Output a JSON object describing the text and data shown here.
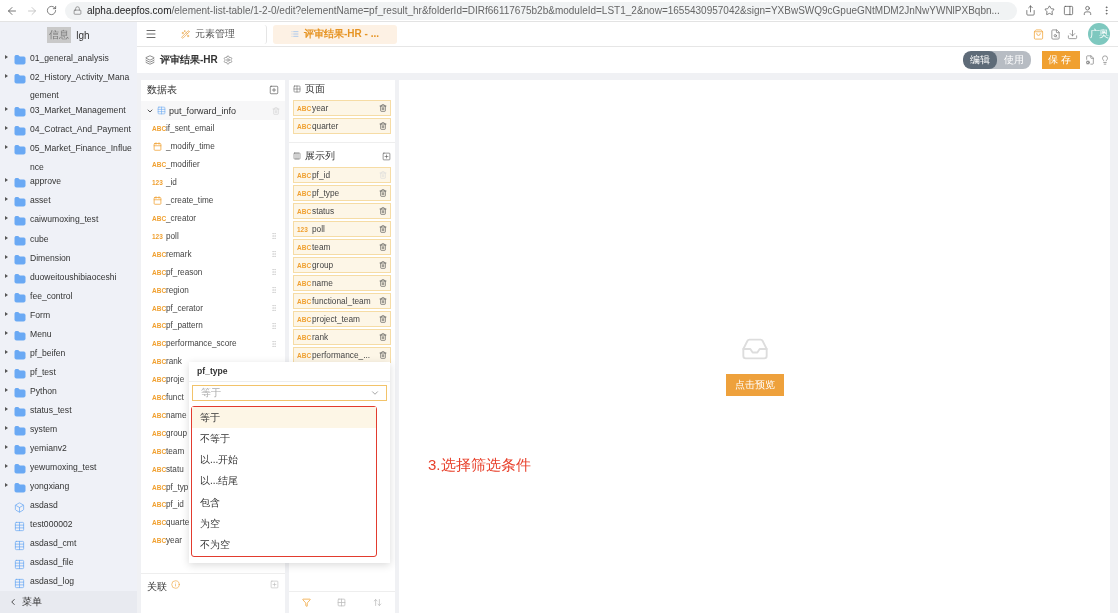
{
  "browser": {
    "url_host": "alpha.deepfos.com",
    "url_path": "/element-list-table/1-2-0/edit?elementName=pf_result_hr&folderId=DIRf66117675b2b&moduleId=LST1_2&now=1655430957042&sign=YXBwSWQ9cGpueGNtMDM2JnNwYWNlPXBqbn..."
  },
  "sidebar": {
    "user_badge": "信息",
    "user": "lgh",
    "footer": "菜单",
    "items": [
      {
        "label": "01_general_analysis",
        "kind": "folder"
      },
      {
        "label": "02_History_Activity_Management",
        "kind": "folder"
      },
      {
        "label": "03_Market_Management",
        "kind": "folder"
      },
      {
        "label": "04_Cotract_And_Payment",
        "kind": "folder"
      },
      {
        "label": "05_Market_Finance_Influence",
        "kind": "folder"
      },
      {
        "label": "approve",
        "kind": "folder"
      },
      {
        "label": "asset",
        "kind": "folder"
      },
      {
        "label": "caiwumoxing_test",
        "kind": "folder"
      },
      {
        "label": "cube",
        "kind": "folder"
      },
      {
        "label": "Dimension",
        "kind": "folder"
      },
      {
        "label": "duoweitoushibiaoceshi",
        "kind": "folder"
      },
      {
        "label": "fee_control",
        "kind": "folder"
      },
      {
        "label": "Form",
        "kind": "folder"
      },
      {
        "label": "Menu",
        "kind": "folder"
      },
      {
        "label": "pf_beifen",
        "kind": "folder"
      },
      {
        "label": "pf_test",
        "kind": "folder"
      },
      {
        "label": "Python",
        "kind": "folder"
      },
      {
        "label": "status_test",
        "kind": "folder"
      },
      {
        "label": "system",
        "kind": "folder"
      },
      {
        "label": "yemianv2",
        "kind": "folder"
      },
      {
        "label": "yewumoxing_test",
        "kind": "folder"
      },
      {
        "label": "yongxiang",
        "kind": "folder"
      },
      {
        "label": "asdasd",
        "kind": "cube"
      },
      {
        "label": "test000002",
        "kind": "table"
      },
      {
        "label": "asdasd_cmt",
        "kind": "table"
      },
      {
        "label": "asdasd_file",
        "kind": "table"
      },
      {
        "label": "asdasd_log",
        "kind": "table"
      }
    ]
  },
  "tabs": [
    {
      "label": "元素管理",
      "selected": false
    },
    {
      "label": "评审结果-HR - ...",
      "selected": true
    }
  ],
  "avatar": "广奥",
  "title": "评审结果-HR",
  "modes": [
    {
      "label": "编辑",
      "selected": true
    },
    {
      "label": "使用",
      "selected": false
    }
  ],
  "save": "保存",
  "data_panel": {
    "title": "数据表",
    "table": {
      "name": "put_forward_info",
      "expanded": true
    },
    "relation": "关联",
    "fields": [
      {
        "name": "if_sent_email",
        "kind": "text",
        "badge": "ABC",
        "handle": false
      },
      {
        "name": "_modify_time",
        "kind": "date",
        "handle": false
      },
      {
        "name": "_modifier",
        "kind": "text",
        "badge": "ABC",
        "handle": false
      },
      {
        "name": "_id",
        "kind": "number",
        "badge": "123",
        "handle": false
      },
      {
        "name": "_create_time",
        "kind": "date",
        "handle": false
      },
      {
        "name": "_creator",
        "kind": "text",
        "badge": "ABC",
        "handle": false
      },
      {
        "name": "poll",
        "kind": "number",
        "badge": "123",
        "handle": true
      },
      {
        "name": "remark",
        "kind": "text",
        "badge": "ABC",
        "handle": true
      },
      {
        "name": "pf_reason",
        "kind": "text",
        "badge": "ABC",
        "handle": true
      },
      {
        "name": "region",
        "kind": "text",
        "badge": "ABC",
        "handle": true
      },
      {
        "name": "pf_cerator",
        "kind": "text",
        "badge": "ABC",
        "handle": true
      },
      {
        "name": "pf_pattern",
        "kind": "text",
        "badge": "ABC",
        "handle": true
      },
      {
        "name": "performance_score",
        "kind": "text",
        "badge": "ABC",
        "handle": true
      },
      {
        "name": "rank",
        "kind": "text",
        "badge": "ABC",
        "handle": false
      },
      {
        "name": "proje",
        "kind": "text",
        "badge": "ABC",
        "handle": false
      },
      {
        "name": "funct",
        "kind": "text",
        "badge": "ABC",
        "handle": false
      },
      {
        "name": "name",
        "kind": "text",
        "badge": "ABC",
        "handle": false
      },
      {
        "name": "group",
        "kind": "text",
        "badge": "ABC",
        "handle": false
      },
      {
        "name": "team",
        "kind": "text",
        "badge": "ABC",
        "handle": false
      },
      {
        "name": "statu",
        "kind": "text",
        "badge": "ABC",
        "handle": false
      },
      {
        "name": "pf_typ",
        "kind": "text",
        "badge": "ABC",
        "handle": false
      },
      {
        "name": "pf_id",
        "kind": "text",
        "badge": "ABC",
        "handle": false
      },
      {
        "name": "quarte",
        "kind": "text",
        "badge": "ABC",
        "handle": false
      },
      {
        "name": "year",
        "kind": "text",
        "badge": "ABC",
        "handle": false
      }
    ]
  },
  "layout_panel": {
    "page_title": "页面",
    "page_fields": [
      {
        "name": "year",
        "badge": "ABC",
        "disabled": false
      },
      {
        "name": "quarter",
        "badge": "ABC",
        "disabled": false
      }
    ],
    "columns_title": "展示列",
    "columns": [
      {
        "name": "pf_id",
        "badge": "ABC",
        "disabled": true
      },
      {
        "name": "pf_type",
        "badge": "ABC",
        "disabled": false
      },
      {
        "name": "status",
        "badge": "ABC",
        "disabled": false
      },
      {
        "name": "poll",
        "badge": "123",
        "disabled": false
      },
      {
        "name": "team",
        "badge": "ABC",
        "disabled": false
      },
      {
        "name": "group",
        "badge": "ABC",
        "disabled": false
      },
      {
        "name": "name",
        "badge": "ABC",
        "disabled": false
      },
      {
        "name": "functional_team",
        "badge": "ABC",
        "disabled": false
      },
      {
        "name": "project_team",
        "badge": "ABC",
        "disabled": false
      },
      {
        "name": "rank",
        "badge": "ABC",
        "disabled": false
      },
      {
        "name": "performance_...",
        "badge": "ABC",
        "disabled": false
      }
    ],
    "toolbar": [
      {
        "kind": "filter",
        "selected": true
      },
      {
        "kind": "grid",
        "selected": false
      },
      {
        "kind": "sort",
        "selected": false
      }
    ]
  },
  "preview": {
    "button": "点击预览"
  },
  "filter_popup": {
    "field": "pf_type",
    "placeholder": "等于",
    "options": [
      {
        "label": "等于",
        "selected": true
      },
      {
        "label": "不等于",
        "selected": false
      },
      {
        "label": "以...开始",
        "selected": false
      },
      {
        "label": "以...结尾",
        "selected": false
      },
      {
        "label": "包含",
        "selected": false
      },
      {
        "label": "为空",
        "selected": false
      },
      {
        "label": "不为空",
        "selected": false
      }
    ]
  },
  "annotation": "3.选择筛选条件"
}
